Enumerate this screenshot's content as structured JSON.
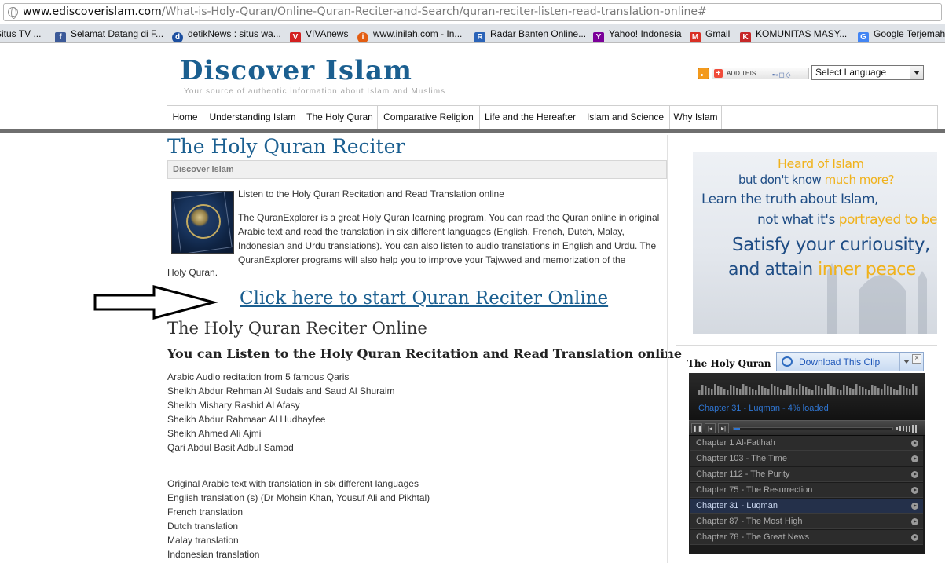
{
  "browser": {
    "url_host": "www.ediscoverislam.com",
    "url_path": "/What-is-Holy-Quran/Online-Quran-Reciter-and-Search/quran-reciter-listen-read-translation-online#",
    "bookmarks": [
      {
        "label": "Situs TV ...",
        "icon": "tv-favicon",
        "color": "#6b6b6b"
      },
      {
        "label": "Selamat Datang di F...",
        "icon": "facebook-favicon",
        "color": "#3b5998"
      },
      {
        "label": "detikNews : situs wa...",
        "icon": "detik-favicon",
        "color": "#1c4fa0"
      },
      {
        "label": "VIVAnews",
        "icon": "vivanews-favicon",
        "color": "#d32020"
      },
      {
        "label": "www.inilah.com - In...",
        "icon": "inilah-favicon",
        "color": "#e35d12"
      },
      {
        "label": "Radar Banten Online...",
        "icon": "radar-banten-favicon",
        "color": "#2a63b8"
      },
      {
        "label": "Yahoo! Indonesia",
        "icon": "yahoo-favicon",
        "color": "#7b0099"
      },
      {
        "label": "Gmail",
        "icon": "gmail-favicon",
        "color": "#d93025"
      },
      {
        "label": "KOMUNITAS MASY...",
        "icon": "komunitas-favicon",
        "color": "#c62828"
      },
      {
        "label": "Google Terjemah",
        "icon": "google-translate-favicon",
        "color": "#4285f4"
      }
    ]
  },
  "header": {
    "title": "Discover Islam",
    "tagline": "Your source of authentic information about Islam and Muslims",
    "addthis_label": "ADD THIS",
    "language_select": "Select Language"
  },
  "nav": [
    "Home",
    "Understanding Islam",
    "The Holy Quran",
    "Comparative Religion",
    "Life and the Hereafter",
    "Islam and Science",
    "Why Islam"
  ],
  "main": {
    "page_title": "The Holy Quran Reciter",
    "breadcrumb": "Discover Islam",
    "intro_line": "Listen to the Holy Quran Recitation and Read Translation online",
    "intro_para": "The QuranExplorer is a great Holy Quran learning program. You can read the Quran online in original Arabic text and read the translation in six different languages (English, French, Dutch, Malay, Indonesian and Urdu translations). You can also listen to audio translations in English and Urdu. The QuranExplorer programs will also help you to improve your Tajwwed and memorization of the",
    "intro_tail": "Holy Quran.",
    "start_link": "Click here to start Quran Reciter Online",
    "heading_reciter": "The Holy Quran Reciter Online",
    "heading_listen": "You can Listen to the Holy Quran Recitation and Read Translation online",
    "qaris": [
      "Arabic Audio recitation from 5 famous Qaris",
      "Sheikh Abdur Rehman Al Sudais and Saud Al Shuraim",
      "Sheikh Mishary Rashid Al Afasy",
      "Sheikh Abdur Rahmaan Al Hudhayfee",
      "Sheikh Ahmed Ali Ajmi",
      "Qari Abdul Basit Adbul Samad"
    ],
    "translations": [
      "Original Arabic text with translation in six different languages",
      "English translation (s) (Dr Mohsin Khan, Yousuf Ali and Pikhtal)",
      "French translation",
      "Dutch translation",
      "Malay translation",
      "Indonesian translation"
    ]
  },
  "sidebar": {
    "banner": {
      "line1": "Heard of Islam",
      "line2a": "but don't know ",
      "line2b": "much more?",
      "line3": "Learn the truth about Islam,",
      "line4a": "not what it's ",
      "line4b": "portrayed to be.",
      "line5": "Satisfy your curiousity,",
      "line6a": "and attain ",
      "line6b": "inner peace"
    },
    "widget_title": "The Holy Quran Reciter",
    "download_label": "Download This Clip",
    "player": {
      "now_playing": "Chapter 31 - Luqman - 4% loaded",
      "progress_percent": 4,
      "active_index": 4,
      "tracks": [
        "Chapter 1 Al-Fatihah",
        "Chapter 103 - The Time",
        "Chapter 112 - The Purity",
        "Chapter 75 - The Resurrection",
        "Chapter 31 - Luqman",
        "Chapter 87 - The Most High",
        "Chapter 78 - The Great News"
      ]
    }
  }
}
